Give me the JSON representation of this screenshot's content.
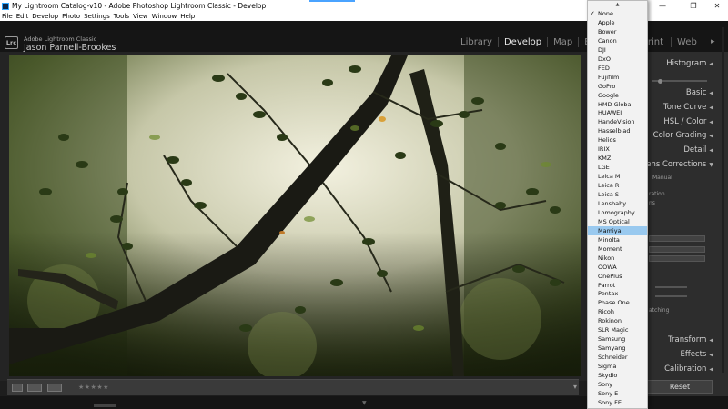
{
  "window": {
    "title": "My Lightroom Catalog-v10 - Adobe Photoshop Lightroom Classic - Develop",
    "controls": {
      "minimize": "—",
      "maximize": "❐",
      "close": "✕"
    }
  },
  "menu": [
    "File",
    "Edit",
    "Develop",
    "Photo",
    "Settings",
    "Tools",
    "View",
    "Window",
    "Help"
  ],
  "identity": {
    "badge": "Lrc",
    "product": "Adobe Lightroom Classic",
    "user": "Jason Parnell-Brookes"
  },
  "modules": {
    "library": "Library",
    "develop": "Develop",
    "map": "Map",
    "book": "Book",
    "print": "Print",
    "web": "Web",
    "active": "Develop"
  },
  "right_panel": {
    "histogram": "Histogram",
    "basic": "Basic",
    "tone_curve": "Tone Curve",
    "hsl": "HSL / Color",
    "color_grading": "Color Grading",
    "detail": "Detail",
    "lens_corrections": "Lens Corrections",
    "frag_manual": "Manual",
    "frag_ration": "ration",
    "frag_ns": "ns",
    "frag_atching": "atching",
    "transform": "Transform",
    "effects": "Effects",
    "calibration": "Calibration",
    "reset": "Reset"
  },
  "toolbar": {
    "stars": "★★★★★"
  },
  "dropdown": {
    "selected": "None",
    "highlighted": "Mamiya",
    "items": [
      "None",
      "Apple",
      "Bower",
      "Canon",
      "DJI",
      "DxO",
      "FED",
      "Fujifilm",
      "GoPro",
      "Google",
      "HMD Global",
      "HUAWEI",
      "HandeVision",
      "Hasselblad",
      "Helios",
      "IRIX",
      "KMZ",
      "LGE",
      "Leica M",
      "Leica R",
      "Leica S",
      "Lensbaby",
      "Lomography",
      "MS Optical",
      "Mamiya",
      "Minolta",
      "Moment",
      "Nikon",
      "OOWA",
      "OnePlus",
      "Parrot",
      "Pentax",
      "Phase One",
      "Ricoh",
      "Rokinon",
      "SLR Magic",
      "Samsung",
      "Samyang",
      "Schneider",
      "Sigma",
      "Skydio",
      "Sony",
      "Sony E",
      "Sony FE"
    ]
  },
  "colors": {
    "highlight": "#99c9ef",
    "panel": "#2d2d2d",
    "background": "#1e1e1e"
  }
}
